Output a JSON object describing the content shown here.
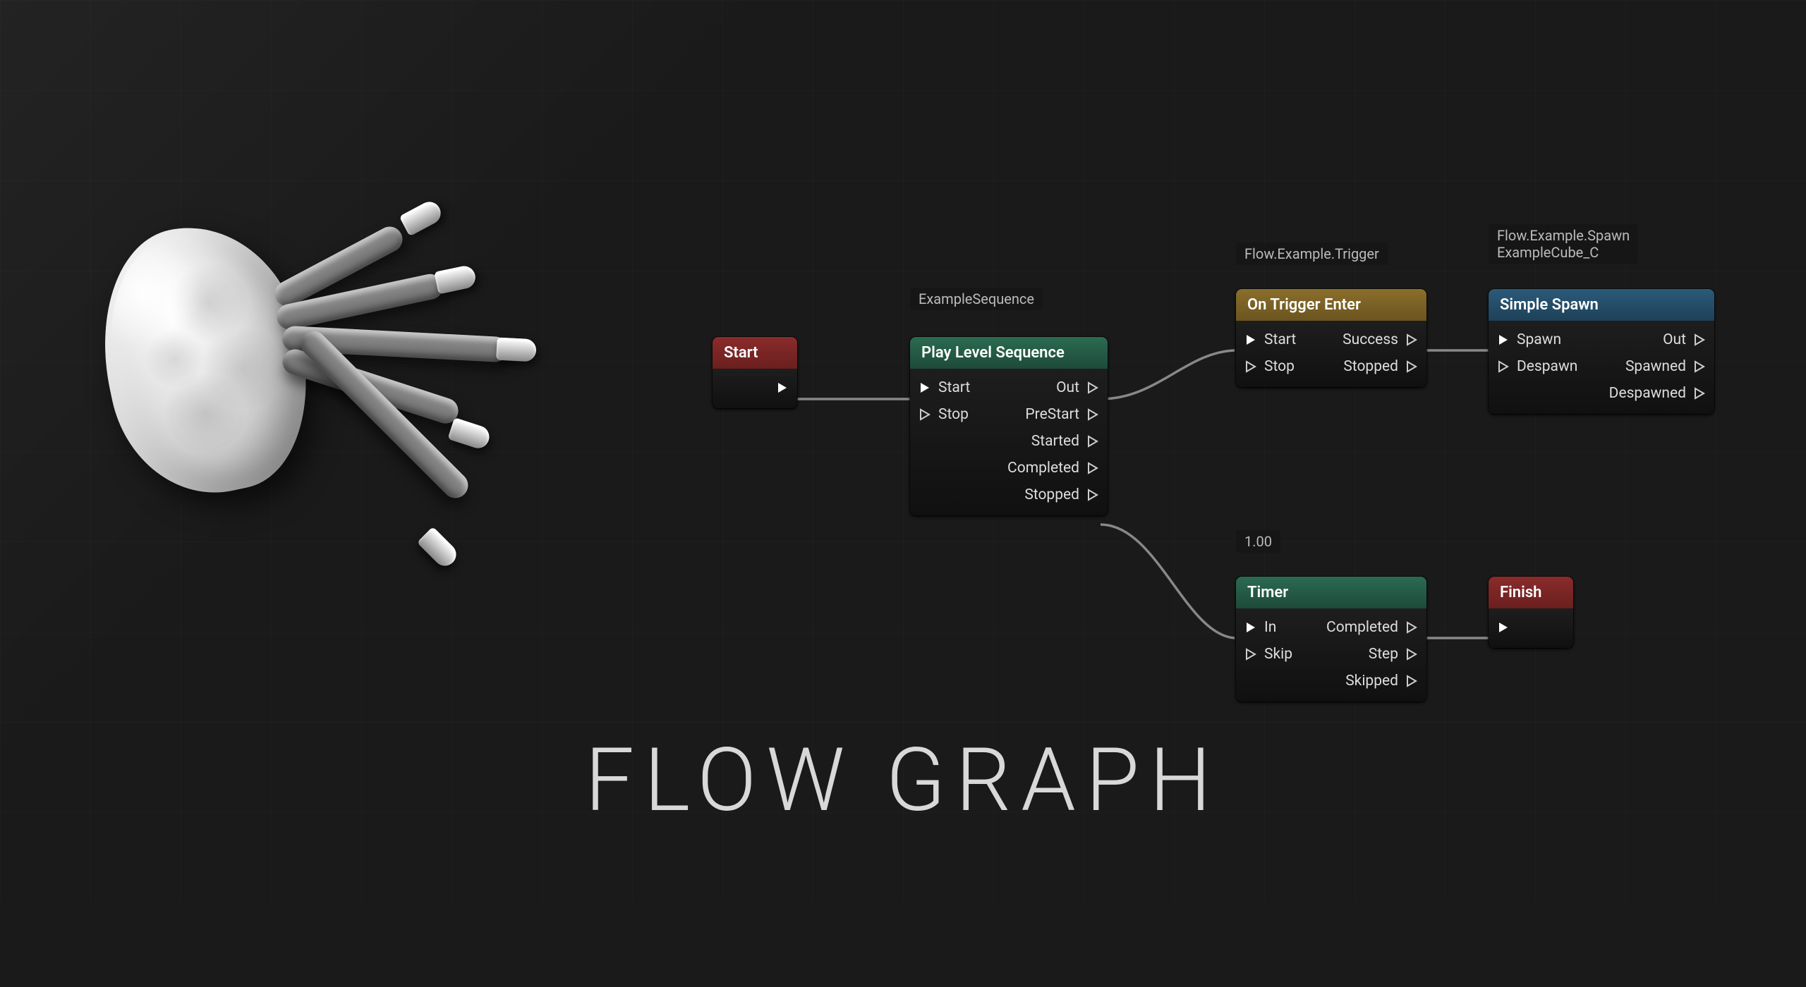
{
  "title": "FLOW GRAPH",
  "labels": {
    "sequence": "ExampleSequence",
    "trigger": "Flow.Example.Trigger",
    "spawn": "Flow.Example.Spawn\nExampleCube_C",
    "timer_val": "1.00"
  },
  "nodes": {
    "start": {
      "title": "Start"
    },
    "play": {
      "title": "Play Level Sequence",
      "pins": {
        "start": "Start",
        "stop": "Stop",
        "out": "Out",
        "prestart": "PreStart",
        "started": "Started",
        "completed": "Completed",
        "stopped": "Stopped"
      }
    },
    "trigger": {
      "title": "On Trigger Enter",
      "pins": {
        "start": "Start",
        "stop": "Stop",
        "success": "Success",
        "stopped": "Stopped"
      }
    },
    "spawn": {
      "title": "Simple Spawn",
      "pins": {
        "spawn": "Spawn",
        "despawn": "Despawn",
        "out": "Out",
        "spawned": "Spawned",
        "despawned": "Despawned"
      }
    },
    "timer": {
      "title": "Timer",
      "pins": {
        "in": "In",
        "skip": "Skip",
        "completed": "Completed",
        "step": "Step",
        "skipped": "Skipped"
      }
    },
    "finish": {
      "title": "Finish"
    }
  }
}
